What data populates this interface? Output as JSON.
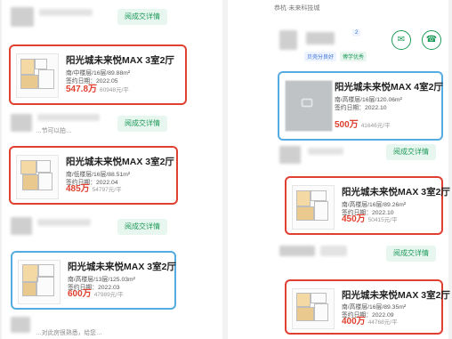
{
  "deal_button_label": "阅成交详情",
  "right_header": {
    "company": "恭杭·未来科技城",
    "tags": [
      "贝壳分良好",
      "傅学优秀"
    ],
    "count_badge": "2",
    "message_icon": "chat-icon",
    "phone_icon": "phone-icon"
  },
  "cards": [
    {
      "title": "阳光城未来悦MAX 3室2厅",
      "floor": "南/中楼层/16层/89.88m²",
      "date": "签约日期：2022.05",
      "price": "547.8万",
      "unit_price": "60948元/平",
      "highlight": "red"
    },
    {
      "title": "阳光城未来悦MAX 3室2厅",
      "floor": "南/低楼层/16层/88.51m²",
      "date": "签约日期：2022.04",
      "price": "485万",
      "unit_price": "54797元/平",
      "highlight": "red"
    },
    {
      "title": "阳光城未来悦MAX 3室2厅",
      "floor": "南/高楼层/13层/125.03m²",
      "date": "签约日期：2022.03",
      "price": "600万",
      "unit_price": "47989元/平",
      "highlight": "blue"
    },
    {
      "title": "阳光城未来悦MAX 4室2厅",
      "floor": "南/高楼层/16层/120.06m²",
      "date": "签约日期：2022.10",
      "price": "500万",
      "unit_price": "41646元/平",
      "highlight": "blue"
    },
    {
      "title": "阳光城未来悦MAX 3室2厅",
      "floor": "南/高楼层/16层/89.26m²",
      "date": "签约日期：2022.10",
      "price": "450万",
      "unit_price": "50415元/平",
      "highlight": "red"
    },
    {
      "title": "阳光城未来悦MAX 3室2厅",
      "floor": "南/高楼层/16层/89.35m²",
      "date": "签约日期：2022.09",
      "price": "400万",
      "unit_price": "44768元/平",
      "highlight": "red"
    }
  ],
  "snippets": {
    "left_mid": "…节可以拍…",
    "left_bottom": "…对此房很熟悉，给您…"
  },
  "colors": {
    "red": "#e0402f",
    "blue": "#55ace2",
    "green": "#1e9a5a"
  }
}
